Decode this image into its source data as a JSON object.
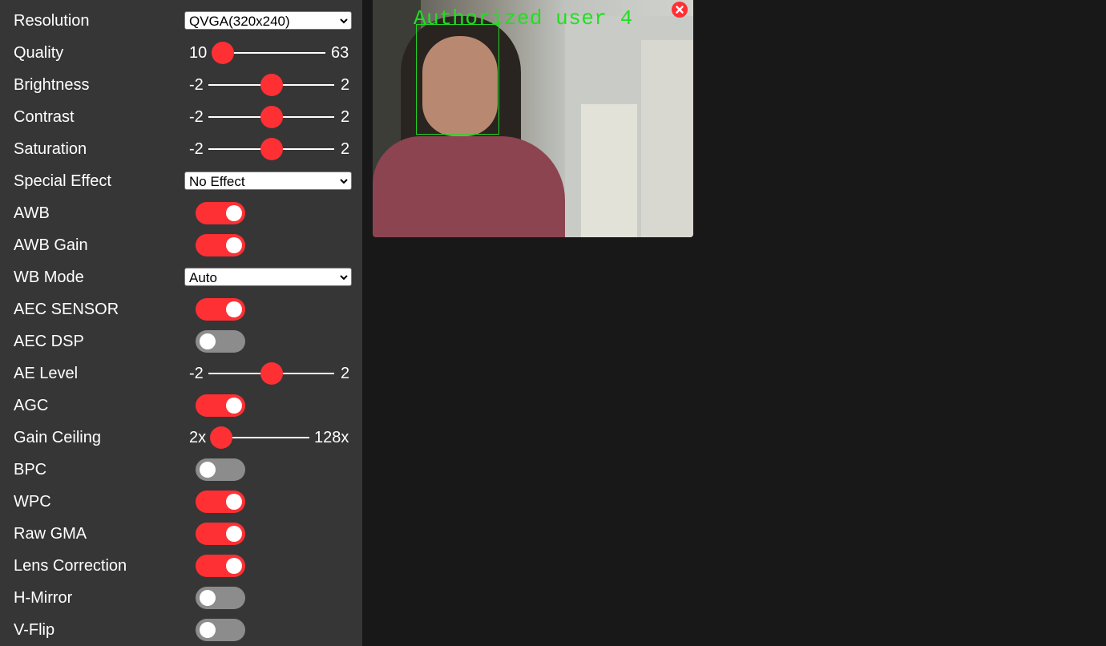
{
  "controls": {
    "resolution": {
      "label": "Resolution",
      "value": "QVGA(320x240)"
    },
    "quality": {
      "label": "Quality",
      "min": "10",
      "max": "63",
      "value": 10
    },
    "brightness": {
      "label": "Brightness",
      "min": "-2",
      "max": "2",
      "value": 0
    },
    "contrast": {
      "label": "Contrast",
      "min": "-2",
      "max": "2",
      "value": 0
    },
    "saturation": {
      "label": "Saturation",
      "min": "-2",
      "max": "2",
      "value": 0
    },
    "special_effect": {
      "label": "Special Effect",
      "value": "No Effect"
    },
    "awb": {
      "label": "AWB",
      "on": true
    },
    "awb_gain": {
      "label": "AWB Gain",
      "on": true
    },
    "wb_mode": {
      "label": "WB Mode",
      "value": "Auto"
    },
    "aec_sensor": {
      "label": "AEC SENSOR",
      "on": true
    },
    "aec_dsp": {
      "label": "AEC DSP",
      "on": false
    },
    "ae_level": {
      "label": "AE Level",
      "min": "-2",
      "max": "2",
      "value": 0
    },
    "agc": {
      "label": "AGC",
      "on": true
    },
    "gain_ceiling": {
      "label": "Gain Ceiling",
      "min": "2x",
      "max": "128x",
      "value": "2x"
    },
    "bpc": {
      "label": "BPC",
      "on": false
    },
    "wpc": {
      "label": "WPC",
      "on": true
    },
    "raw_gma": {
      "label": "Raw GMA",
      "on": true
    },
    "lens_correction": {
      "label": "Lens Correction",
      "on": true
    },
    "h_mirror": {
      "label": "H-Mirror",
      "on": false
    },
    "v_flip": {
      "label": "V-Flip",
      "on": false
    }
  },
  "stream": {
    "overlay_text": "Authorized user 4"
  },
  "colors": {
    "accent": "#ff3034",
    "panel": "#363636",
    "background": "#181818",
    "overlay_green": "#1fe01f"
  },
  "icons": {
    "close": "close-icon",
    "dropdown": "chevron-down-icon"
  }
}
